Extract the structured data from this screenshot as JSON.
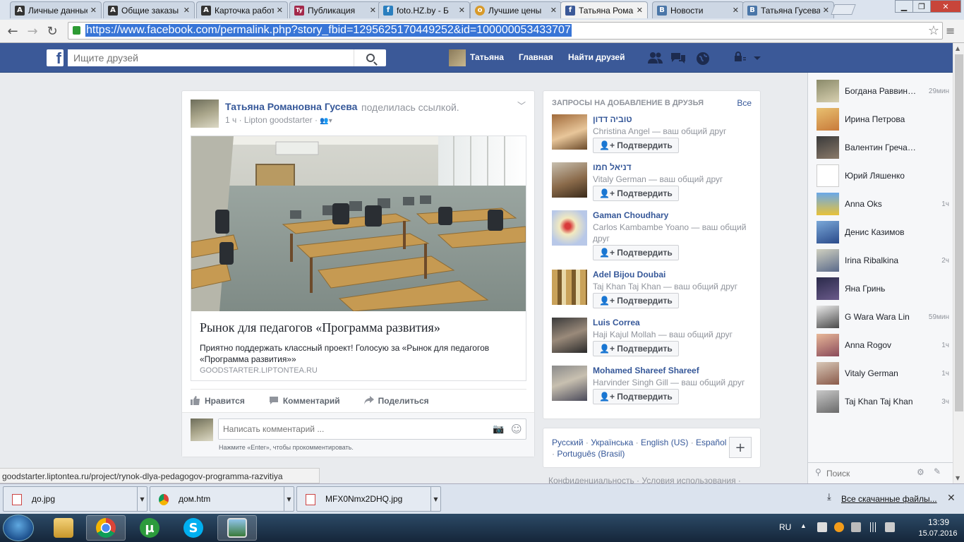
{
  "browser": {
    "tabs": [
      {
        "label": "Личные данные",
        "icon": "A"
      },
      {
        "label": "Общие заказы",
        "icon": "A"
      },
      {
        "label": "Карточка работы",
        "icon": "A"
      },
      {
        "label": "Публикация",
        "icon": "Ty"
      },
      {
        "label": "foto.HZ.by - Б",
        "icon": "f"
      },
      {
        "label": "Лучшие цены",
        "icon": "o"
      },
      {
        "label": "Татьяна Романовна",
        "icon": "f"
      },
      {
        "label": "Новости",
        "icon": "B"
      },
      {
        "label": "Татьяна Гусева",
        "icon": "B"
      }
    ],
    "url": "https://www.facebook.com/permalink.php?story_fbid=1295625170449252&id=100000053433707",
    "status_url": "goodstarter.liptontea.ru/project/rynok-dlya-pedagogov-programma-razvitiya"
  },
  "fb_header": {
    "search_placeholder": "Ищите друзей",
    "user_name": "Татьяна",
    "home": "Главная",
    "find_friends": "Найти друзей"
  },
  "post": {
    "author": "Татьяна Романовна Гусева",
    "action": "поделилась ссылкой.",
    "meta": "1 ч · Lipton goodstarter ·",
    "link_title": "Рынок для педагогов «Программа развития»",
    "link_desc": "Приятно поддержать классный проект! Голосую за «Рынок для педагогов «Программа развития»»",
    "link_domain": "GOODSTARTER.LIPTONTEA.RU",
    "like": "Нравится",
    "comment": "Комментарий",
    "share": "Поделиться",
    "comment_placeholder": "Написать комментарий ...",
    "comment_hint": "Нажмите «Enter», чтобы прокомментировать."
  },
  "requests": {
    "title": "ЗАПРОСЫ НА ДОБАВЛЕНИЕ В ДРУЗЬЯ",
    "see_all": "Все",
    "confirm": "Подтвердить",
    "items": [
      {
        "name": "טוביה דדון",
        "mutual": "Christina Angel — ваш общий друг"
      },
      {
        "name": "דניאל חמו",
        "mutual": "Vitaly German — ваш общий друг"
      },
      {
        "name": "Gaman Choudhary",
        "mutual": "Carlos Kambambe Yoano — ваш общий друг"
      },
      {
        "name": "Adel Bijou Doubai",
        "mutual": "Taj Khan Taj Khan — ваш общий друг"
      },
      {
        "name": "Luis Correa",
        "mutual": "Haji Kajul Mollah — ваш общий друг"
      },
      {
        "name": "Mohamed Shareef Shareef",
        "mutual": "Harvinder Singh Gill — ваш общий друг"
      }
    ]
  },
  "languages": {
    "items": [
      "Русский",
      "Українська",
      "English (US)",
      "Español",
      "Português (Brasil)"
    ],
    "separator": "·"
  },
  "footer": "Конфиденциальность · Условия использования ·",
  "chat": {
    "contacts": [
      {
        "name": "Богдана Раввинова",
        "time": "29мин"
      },
      {
        "name": "Ирина Петрова",
        "time": ""
      },
      {
        "name": "Валентин Гречаный",
        "time": ""
      },
      {
        "name": "Юрий Ляшенко",
        "time": ""
      },
      {
        "name": "Anna Oks",
        "time": "1ч"
      },
      {
        "name": "Денис Казимов",
        "time": ""
      },
      {
        "name": "Irina Ribalkina",
        "time": "2ч"
      },
      {
        "name": "Яна Гринь",
        "time": ""
      },
      {
        "name": "G Wara Wara Lin",
        "time": "59мин"
      },
      {
        "name": "Anna Rogov",
        "time": "1ч"
      },
      {
        "name": "Vitaly German",
        "time": "1ч"
      },
      {
        "name": "Taj Khan Taj Khan",
        "time": "3ч"
      }
    ],
    "search_placeholder": "Поиск"
  },
  "downloads": {
    "files": [
      "до.jpg",
      "дом.htm",
      "MFX0Nmx2DHQ.jpg"
    ],
    "all_label": "Все скачанные файлы..."
  },
  "taskbar": {
    "lang": "RU",
    "time": "13:39",
    "date": "15.07.2016"
  },
  "colors": {
    "fb_blue": "#3b5998",
    "link_blue": "#365899",
    "url_highlight": "#3875d7"
  }
}
